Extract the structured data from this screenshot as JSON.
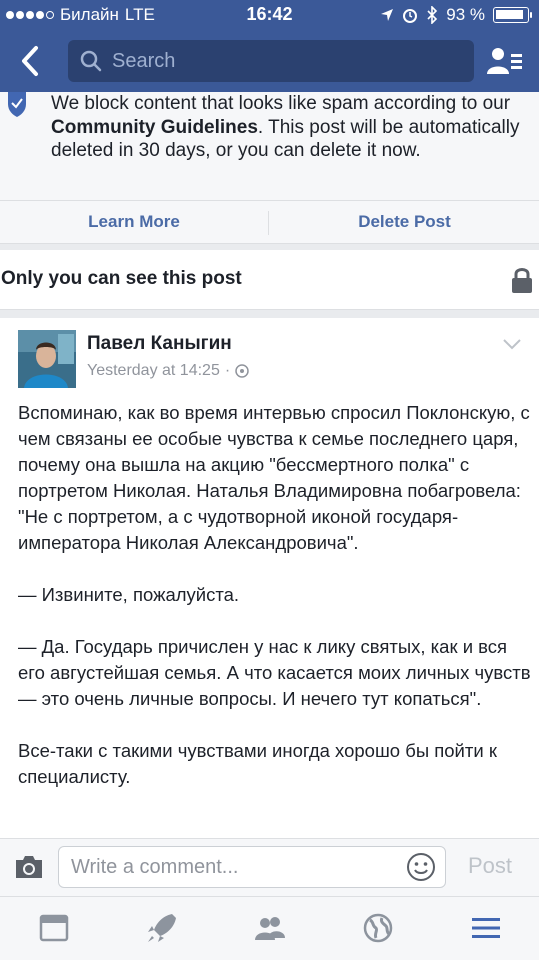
{
  "status_bar": {
    "carrier": "Билайн",
    "network": "LTE",
    "time": "16:42",
    "battery_text": "93 %",
    "battery_level": 0.93
  },
  "search": {
    "placeholder": "Search"
  },
  "notice": {
    "text_before": "We block content that looks like spam according to our ",
    "link": "Community Guidelines",
    "text_after": ". This post will be automatically deleted in 30 days, or you can delete it now."
  },
  "actions": {
    "learn_more": "Learn More",
    "delete_post": "Delete Post"
  },
  "privacy": {
    "label": "Only you can see this post"
  },
  "post": {
    "author": "Павел Каныгин",
    "timestamp": "Yesterday at 14:25",
    "separator": "·",
    "paragraphs": [
      "Вспоминаю, как во время интервью спросил Поклонскую, с чем связаны ее особые чувства к семье последнего царя, почему она вышла на акцию \"бессмертного полка\" с портретом Николая. Наталья Владимировна побагровела: \"Не с портретом, а с чудотворной иконой государя-императора Николая Александровича\".",
      "— Извините, пожалуйста.",
      "— Да. Государь причислен у нас к лику святых, как и вся его августейшая семья. А что касается моих личных чувств — это очень личные вопросы. И нечего тут копаться\".",
      "Все-таки с такими чувствами иногда  хорошо бы пойти к специалисту."
    ]
  },
  "comment": {
    "placeholder": "Write a comment...",
    "post_label": "Post"
  },
  "colors": {
    "brand": "#3b5998",
    "link": "#4b6ba6",
    "muted": "#90949c"
  }
}
